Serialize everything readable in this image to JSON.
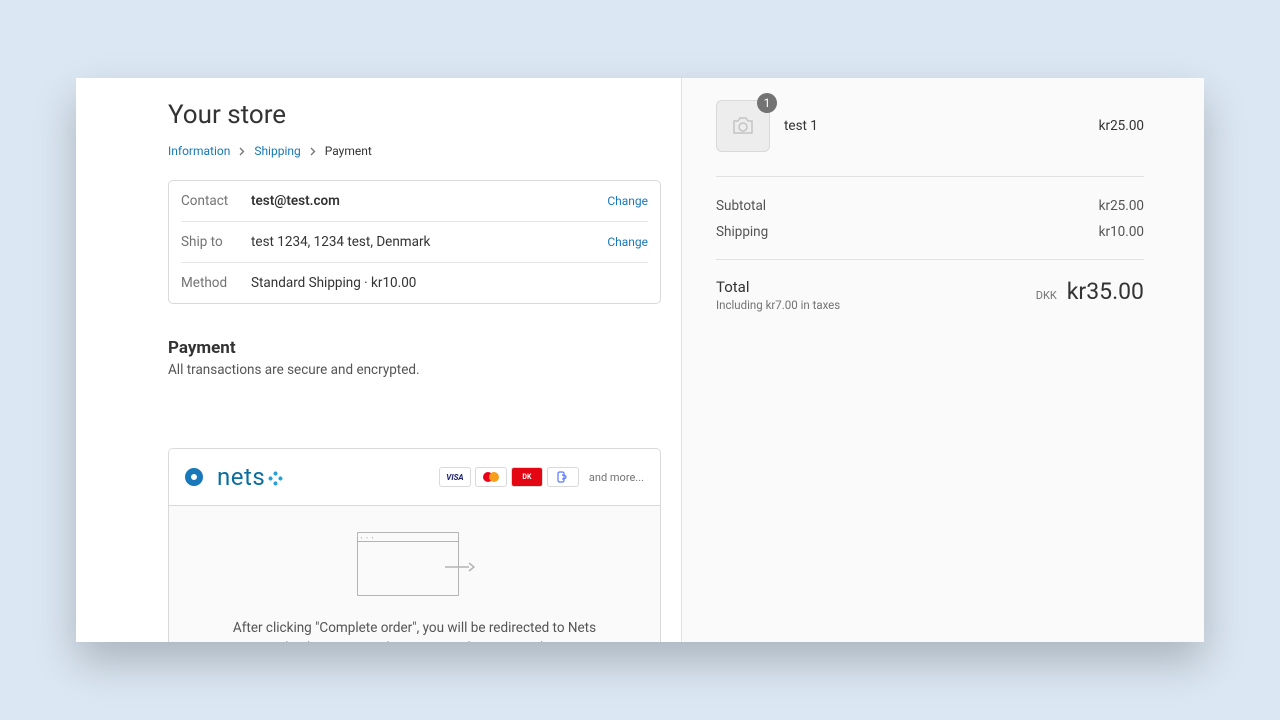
{
  "store_title": "Your store",
  "breadcrumb": {
    "information": "Information",
    "shipping": "Shipping",
    "payment": "Payment"
  },
  "review": {
    "contact_label": "Contact",
    "contact_value": "test@test.com",
    "shipto_label": "Ship to",
    "shipto_value": "test 1234, 1234 test, Denmark",
    "method_label": "Method",
    "method_value": "Standard Shipping · kr10.00",
    "change": "Change"
  },
  "payment_section": {
    "title": "Payment",
    "subtitle": "All transactions are secure and encrypted."
  },
  "payment_method": {
    "name": "nets",
    "more_text": "and more...",
    "redirect_text": "After clicking \"Complete order\", you will be redirected to Nets Checkout to complete your purchase securely."
  },
  "cart": {
    "items": [
      {
        "name": "test 1",
        "qty": "1",
        "price": "kr25.00"
      }
    ]
  },
  "totals": {
    "subtotal_label": "Subtotal",
    "subtotal_value": "kr25.00",
    "shipping_label": "Shipping",
    "shipping_value": "kr10.00",
    "total_label": "Total",
    "tax_note": "Including kr7.00 in taxes",
    "currency": "DKK",
    "total_value": "kr35.00"
  }
}
